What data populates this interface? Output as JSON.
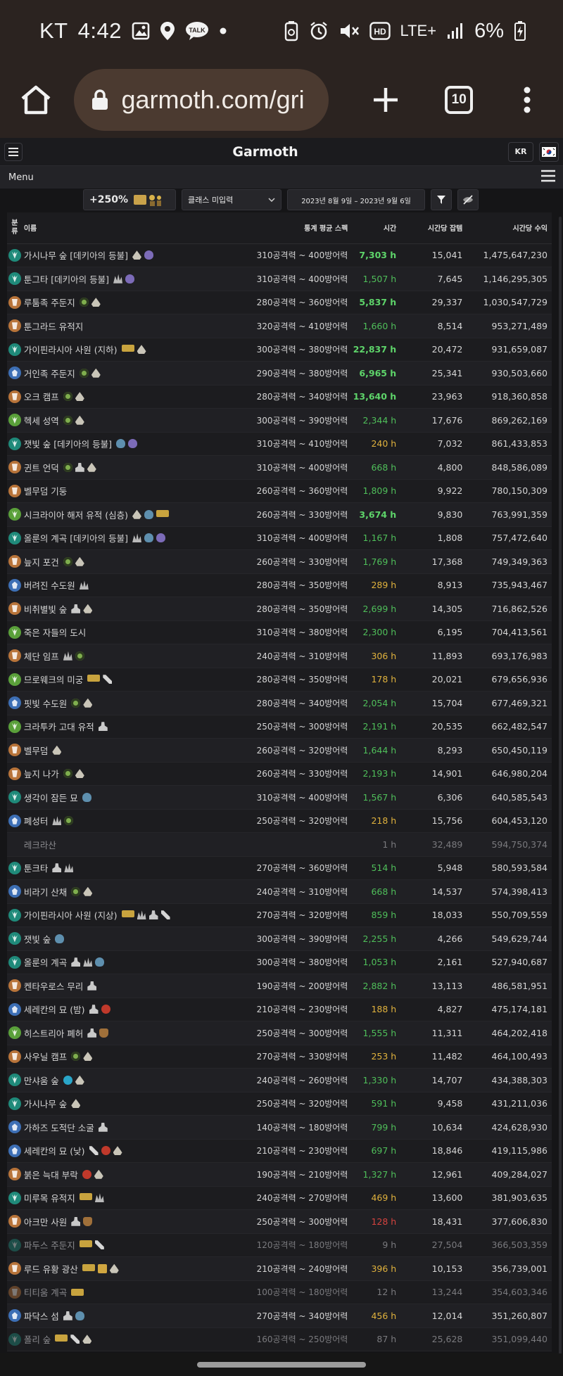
{
  "status_bar": {
    "carrier": "KT",
    "time": "4:42",
    "talk_label": "TALK",
    "network": "LTE+",
    "battery": "6%"
  },
  "browser": {
    "url": "garmoth.com/gri",
    "tab_count": "10"
  },
  "header": {
    "logo": "Garmoth",
    "lang": "KR",
    "menu_label": "Menu"
  },
  "filters": {
    "bonus": "+250%",
    "class_placeholder": "클래스 미입력",
    "date_range": "2023년 8월 9일  –  2023년 9월 6일"
  },
  "table": {
    "headers": {
      "cls": [
        "분",
        "류"
      ],
      "name": "이름",
      "spec": "통계 평균 스펙",
      "time": "시간",
      "loot": "시간당 잡템",
      "income": "시간당 수익"
    },
    "rows": [
      {
        "cls": "#1f8a7a",
        "shape": "dragon",
        "name": "가시나무 숲 [데키아의 등불]",
        "tags": [
          "fire",
          "potion"
        ],
        "spec": "310공격력 ~ 400방어력",
        "time": "7,303 h",
        "tc": "t-high",
        "loot": "15,041",
        "income": "1,475,647,230"
      },
      {
        "cls": "#1f8a7a",
        "shape": "dragon",
        "name": "툰그타 [데키아의 등불]",
        "tags": [
          "claw",
          "potion"
        ],
        "spec": "310공격력 ~ 400방어력",
        "time": "1,507 h",
        "tc": "t-good",
        "loot": "7,645",
        "income": "1,146,295,305"
      },
      {
        "cls": "#b8743a",
        "shape": "orc",
        "name": "루툼족 주둔지",
        "tags": [
          "eye",
          "fire"
        ],
        "spec": "280공격력 ~ 360방어력",
        "time": "5,837 h",
        "tc": "t-high",
        "loot": "29,337",
        "income": "1,030,547,729"
      },
      {
        "cls": "#b8743a",
        "shape": "orc",
        "name": "툰그라드 유적지",
        "tags": [],
        "spec": "320공격력 ~ 410방어력",
        "time": "1,660 h",
        "tc": "t-good",
        "loot": "8,514",
        "income": "953,271,489"
      },
      {
        "cls": "#1f8a7a",
        "shape": "dragon",
        "name": "가이핀라시아 사원 (지하)",
        "tags": [
          "exp",
          "fire"
        ],
        "spec": "300공격력 ~ 380방어력",
        "time": "22,837 h",
        "tc": "t-high",
        "loot": "20,472",
        "income": "931,659,087"
      },
      {
        "cls": "#3d6fb5",
        "shape": "human",
        "name": "거인족 주둔지",
        "tags": [
          "eye",
          "fire"
        ],
        "spec": "290공격력 ~ 380방어력",
        "time": "6,965 h",
        "tc": "t-high",
        "loot": "25,341",
        "income": "930,503,660"
      },
      {
        "cls": "#b8743a",
        "shape": "orc",
        "name": "오크 캠프",
        "tags": [
          "eye",
          "fire"
        ],
        "spec": "280공격력 ~ 340방어력",
        "time": "13,640 h",
        "tc": "t-high",
        "loot": "23,963",
        "income": "918,360,858"
      },
      {
        "cls": "#5aa03a",
        "shape": "dragon",
        "name": "헥세 성역",
        "tags": [
          "eye",
          "fire"
        ],
        "spec": "300공격력 ~ 390방어력",
        "time": "2,344 h",
        "tc": "t-good",
        "loot": "17,676",
        "income": "869,262,169"
      },
      {
        "cls": "#1f8a7a",
        "shape": "dragon",
        "name": "잿빛 숲 [데키아의 등불]",
        "tags": [
          "frog",
          "potion"
        ],
        "spec": "310공격력 ~ 410방어력",
        "time": "240 h",
        "tc": "t-mid",
        "loot": "7,032",
        "income": "861,433,853"
      },
      {
        "cls": "#b8743a",
        "shape": "orc",
        "name": "귄트 언덕",
        "tags": [
          "eye",
          "altar",
          "fire"
        ],
        "spec": "310공격력 ~ 400방어력",
        "time": "668 h",
        "tc": "t-good",
        "loot": "4,800",
        "income": "848,586,089"
      },
      {
        "cls": "#b8743a",
        "shape": "orc",
        "name": "벨무덤 기둥",
        "tags": [],
        "spec": "260공격력 ~ 360방어력",
        "time": "1,809 h",
        "tc": "t-good",
        "loot": "9,922",
        "income": "780,150,309"
      },
      {
        "cls": "#5aa03a",
        "shape": "dragon",
        "name": "시크라이아 해저 유적 (심층)",
        "tags": [
          "fire",
          "frog",
          "exp"
        ],
        "spec": "260공격력 ~ 330방어력",
        "time": "3,674 h",
        "tc": "t-high",
        "loot": "9,830",
        "income": "763,991,359"
      },
      {
        "cls": "#1f8a7a",
        "shape": "dragon",
        "name": "올룬의 계곡 [데키아의 등불]",
        "tags": [
          "claw",
          "frog",
          "potion"
        ],
        "spec": "310공격력 ~ 400방어력",
        "time": "1,167 h",
        "tc": "t-good",
        "loot": "1,808",
        "income": "757,472,640"
      },
      {
        "cls": "#b8743a",
        "shape": "orc",
        "name": "늪지 포건",
        "tags": [
          "eye",
          "fire"
        ],
        "spec": "260공격력 ~ 330방어력",
        "time": "1,769 h",
        "tc": "t-good",
        "loot": "17,368",
        "income": "749,349,363"
      },
      {
        "cls": "#3d6fb5",
        "shape": "human",
        "name": "버려진 수도원",
        "tags": [
          "claw"
        ],
        "spec": "280공격력 ~ 350방어력",
        "time": "289 h",
        "tc": "t-mid",
        "loot": "8,913",
        "income": "735,943,467"
      },
      {
        "cls": "#b8743a",
        "shape": "orc",
        "name": "비취별빛 숲",
        "tags": [
          "altar",
          "fire"
        ],
        "spec": "280공격력 ~ 350방어력",
        "time": "2,699 h",
        "tc": "t-good",
        "loot": "14,305",
        "income": "716,862,526"
      },
      {
        "cls": "#5aa03a",
        "shape": "dragon",
        "name": "죽은 자들의 도시",
        "tags": [],
        "spec": "310공격력 ~ 380방어력",
        "time": "2,300 h",
        "tc": "t-good",
        "loot": "6,195",
        "income": "704,413,561"
      },
      {
        "cls": "#b8743a",
        "shape": "orc",
        "name": "체단 임프",
        "tags": [
          "claw",
          "eye"
        ],
        "spec": "240공격력 ~ 310방어력",
        "time": "306 h",
        "tc": "t-mid",
        "loot": "11,893",
        "income": "693,176,983"
      },
      {
        "cls": "#5aa03a",
        "shape": "dragon",
        "name": "므로웨크의 미궁",
        "tags": [
          "exp",
          "pick"
        ],
        "spec": "280공격력 ~ 350방어력",
        "time": "178 h",
        "tc": "t-mid",
        "loot": "20,021",
        "income": "679,656,936"
      },
      {
        "cls": "#3d6fb5",
        "shape": "human",
        "name": "핏빛 수도원",
        "tags": [
          "eye",
          "fire"
        ],
        "spec": "280공격력 ~ 340방어력",
        "time": "2,054 h",
        "tc": "t-good",
        "loot": "15,704",
        "income": "677,469,321"
      },
      {
        "cls": "#5aa03a",
        "shape": "dragon",
        "name": "크라투카 고대 유적",
        "tags": [
          "altar"
        ],
        "spec": "250공격력 ~ 300방어력",
        "time": "2,191 h",
        "tc": "t-good",
        "loot": "20,535",
        "income": "662,482,547"
      },
      {
        "cls": "#b8743a",
        "shape": "orc",
        "name": "벨무덤",
        "tags": [
          "fire"
        ],
        "spec": "260공격력 ~ 320방어력",
        "time": "1,644 h",
        "tc": "t-good",
        "loot": "8,293",
        "income": "650,450,119"
      },
      {
        "cls": "#b8743a",
        "shape": "orc",
        "name": "늪지 나가",
        "tags": [
          "eye",
          "fire"
        ],
        "spec": "260공격력 ~ 330방어력",
        "time": "2,193 h",
        "tc": "t-good",
        "loot": "14,901",
        "income": "646,980,204"
      },
      {
        "cls": "#1f8a7a",
        "shape": "dragon",
        "name": "생각이 잠든 묘",
        "tags": [
          "frog"
        ],
        "spec": "310공격력 ~ 400방어력",
        "time": "1,567 h",
        "tc": "t-good",
        "loot": "6,306",
        "income": "640,585,543"
      },
      {
        "cls": "#3d6fb5",
        "shape": "human",
        "name": "폐성터",
        "tags": [
          "claw",
          "eye"
        ],
        "spec": "250공격력 ~ 320방어력",
        "time": "218 h",
        "tc": "t-mid",
        "loot": "15,756",
        "income": "604,453,120"
      },
      {
        "cls": "",
        "shape": "",
        "name": "레크라산",
        "tags": [],
        "spec": "",
        "time": "1 h",
        "tc": "t-low",
        "loot": "32,489",
        "income": "594,750,374",
        "dim": true
      },
      {
        "cls": "#1f8a7a",
        "shape": "dragon",
        "name": "툰크타",
        "tags": [
          "altar",
          "claw"
        ],
        "spec": "270공격력 ~ 360방어력",
        "time": "514 h",
        "tc": "t-good",
        "loot": "5,948",
        "income": "580,593,584"
      },
      {
        "cls": "#3d6fb5",
        "shape": "human",
        "name": "비라기 산채",
        "tags": [
          "eye",
          "fire"
        ],
        "spec": "240공격력 ~ 310방어력",
        "time": "668 h",
        "tc": "t-good",
        "loot": "14,537",
        "income": "574,398,413"
      },
      {
        "cls": "#1f8a7a",
        "shape": "dragon",
        "name": "가이핀라시아 사원 (지상)",
        "tags": [
          "exp",
          "claw",
          "altar",
          "pick"
        ],
        "spec": "270공격력 ~ 320방어력",
        "time": "859 h",
        "tc": "t-good",
        "loot": "18,033",
        "income": "550,709,559"
      },
      {
        "cls": "#1f8a7a",
        "shape": "dragon",
        "name": "잿빛 숲",
        "tags": [
          "frog"
        ],
        "spec": "300공격력 ~ 390방어력",
        "time": "2,255 h",
        "tc": "t-good",
        "loot": "4,266",
        "income": "549,629,744"
      },
      {
        "cls": "#1f8a7a",
        "shape": "dragon",
        "name": "올룬의 계곡",
        "tags": [
          "altar",
          "claw",
          "frog"
        ],
        "spec": "300공격력 ~ 380방어력",
        "time": "1,053 h",
        "tc": "t-good",
        "loot": "2,161",
        "income": "527,940,687"
      },
      {
        "cls": "#b8743a",
        "shape": "orc",
        "name": "켄타우로스 무리",
        "tags": [
          "altar"
        ],
        "spec": "190공격력 ~ 200방어력",
        "time": "2,882 h",
        "tc": "t-good",
        "loot": "13,113",
        "income": "486,581,951"
      },
      {
        "cls": "#3d6fb5",
        "shape": "human",
        "name": "세레칸의 묘 (밤)",
        "tags": [
          "altar",
          "red"
        ],
        "spec": "210공격력 ~ 230방어력",
        "time": "188 h",
        "tc": "t-mid",
        "loot": "4,827",
        "income": "475,174,181"
      },
      {
        "cls": "#5aa03a",
        "shape": "dragon",
        "name": "히스트리아 폐허",
        "tags": [
          "altar",
          "bag"
        ],
        "spec": "250공격력 ~ 300방어력",
        "time": "1,555 h",
        "tc": "t-good",
        "loot": "11,311",
        "income": "464,202,418"
      },
      {
        "cls": "#b8743a",
        "shape": "orc",
        "name": "사우닐 캠프",
        "tags": [
          "eye",
          "fire"
        ],
        "spec": "270공격력 ~ 330방어력",
        "time": "253 h",
        "tc": "t-mid",
        "loot": "11,482",
        "income": "464,100,493"
      },
      {
        "cls": "#1f8a7a",
        "shape": "dragon",
        "name": "만샤움 숲",
        "tags": [
          "crystal",
          "fire"
        ],
        "spec": "240공격력 ~ 260방어력",
        "time": "1,330 h",
        "tc": "t-good",
        "loot": "14,707",
        "income": "434,388,303"
      },
      {
        "cls": "#1f8a7a",
        "shape": "dragon",
        "name": "가시나무 숲",
        "tags": [
          "fire"
        ],
        "spec": "250공격력 ~ 320방어력",
        "time": "591 h",
        "tc": "t-good",
        "loot": "9,458",
        "income": "431,211,036"
      },
      {
        "cls": "#3d6fb5",
        "shape": "human",
        "name": "가하즈 도적단 소굴",
        "tags": [
          "altar"
        ],
        "spec": "140공격력 ~ 180방어력",
        "time": "799 h",
        "tc": "t-good",
        "loot": "10,634",
        "income": "424,628,930"
      },
      {
        "cls": "#3d6fb5",
        "shape": "human",
        "name": "세레칸의 묘 (낮)",
        "tags": [
          "pick",
          "red",
          "fire"
        ],
        "spec": "210공격력 ~ 230방어력",
        "time": "697 h",
        "tc": "t-good",
        "loot": "18,846",
        "income": "419,115,986"
      },
      {
        "cls": "#b8743a",
        "shape": "orc",
        "name": "붉은 늑대 부락",
        "tags": [
          "red",
          "fire"
        ],
        "spec": "190공격력 ~ 210방어력",
        "time": "1,327 h",
        "tc": "t-good",
        "loot": "12,961",
        "income": "409,284,027"
      },
      {
        "cls": "#1f8a7a",
        "shape": "dragon",
        "name": "미루목 유적지",
        "tags": [
          "exp",
          "claw"
        ],
        "spec": "240공격력 ~ 270방어력",
        "time": "469 h",
        "tc": "t-mid",
        "loot": "13,600",
        "income": "381,903,635"
      },
      {
        "cls": "#b8743a",
        "shape": "orc",
        "name": "아크만 사원",
        "tags": [
          "altar",
          "bag"
        ],
        "spec": "250공격력 ~ 300방어력",
        "time": "128 h",
        "tc": "t-low",
        "loot": "18,431",
        "income": "377,606,830"
      },
      {
        "cls": "#1f8a7a",
        "shape": "dragon",
        "name": "파두스 주둔지",
        "tags": [
          "exp",
          "pick"
        ],
        "spec": "120공격력 ~ 180방어력",
        "time": "9 h",
        "tc": "t-low",
        "loot": "27,504",
        "income": "366,503,359",
        "dim": true
      },
      {
        "cls": "#b8743a",
        "shape": "orc",
        "name": "루드 유황 광산",
        "tags": [
          "exp",
          "dice",
          "fire"
        ],
        "spec": "210공격력 ~ 240방어력",
        "time": "396 h",
        "tc": "t-mid",
        "loot": "10,153",
        "income": "356,739,001"
      },
      {
        "cls": "#b8743a",
        "shape": "orc",
        "name": "티티움 계곡",
        "tags": [
          "exp"
        ],
        "spec": "100공격력 ~ 180방어력",
        "time": "12 h",
        "tc": "t-low",
        "loot": "13,244",
        "income": "354,603,346",
        "dim": true
      },
      {
        "cls": "#3d6fb5",
        "shape": "human",
        "name": "파닥스 섬",
        "tags": [
          "altar",
          "frog"
        ],
        "spec": "270공격력 ~ 340방어력",
        "time": "456 h",
        "tc": "t-mid",
        "loot": "12,014",
        "income": "351,260,807"
      },
      {
        "cls": "#1f8a7a",
        "shape": "dragon",
        "name": "폴리 숲",
        "tags": [
          "exp",
          "pick",
          "fire"
        ],
        "spec": "160공격력 ~ 250방어력",
        "time": "87 h",
        "tc": "t-low",
        "loot": "25,628",
        "income": "351,099,440",
        "dim": true
      }
    ]
  }
}
